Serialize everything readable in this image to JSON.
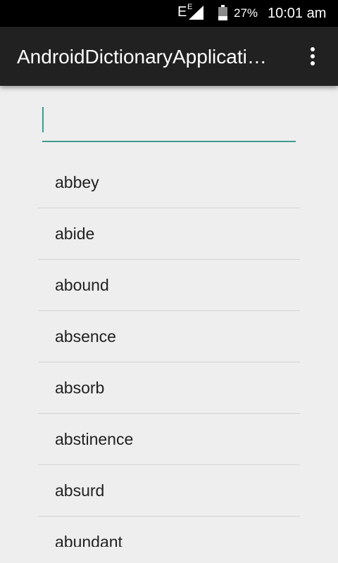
{
  "status_bar": {
    "network": "E",
    "network_sup": "E",
    "battery": "27%",
    "time": "10:01 am"
  },
  "app_bar": {
    "title": "AndroidDictionaryApplicati…",
    "overflow_icon": "more-vert-icon"
  },
  "search": {
    "value": "",
    "placeholder": ""
  },
  "words": [
    "abbey",
    "abide",
    "abound",
    "absence",
    "absorb",
    "abstinence",
    "absurd",
    "abundant"
  ],
  "colors": {
    "app_bar": "#212121",
    "accent": "#3f9c8f",
    "background": "#eeeeee"
  }
}
